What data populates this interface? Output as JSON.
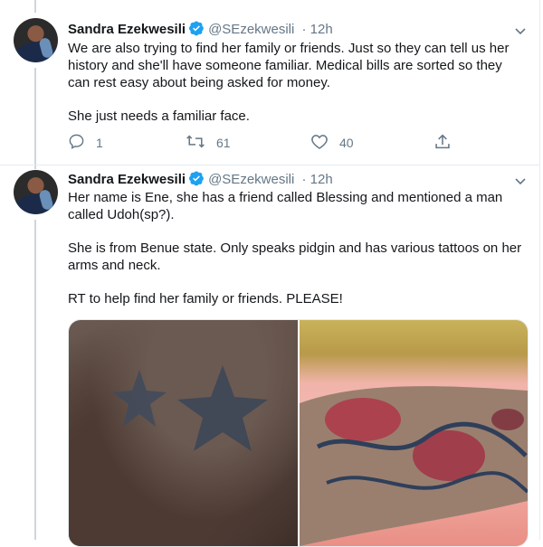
{
  "tweets": [
    {
      "author_name": "Sandra Ezekwesili",
      "handle": "@SEzekwesili",
      "time": "· 12h",
      "paragraphs": [
        "We are also trying to find her family or friends. Just so they can tell us her history and she'll have someone familiar. Medical bills are sorted so they can rest easy about being asked for money.",
        "She just needs a familiar face."
      ],
      "replies": "1",
      "retweets": "61",
      "likes": "40"
    },
    {
      "author_name": "Sandra Ezekwesili",
      "handle": "@SEzekwesili",
      "time": "· 12h",
      "paragraphs": [
        "Her name is Ene, she has a friend called Blessing and mentioned a man called Udoh(sp?).",
        "She is from Benue state. Only speaks pidgin and has various tattoos on her arms and neck.",
        "RT to help find her family or friends. PLEASE!"
      ]
    }
  ],
  "icons": {
    "verified": "verified-badge-icon",
    "reply": "reply-icon",
    "retweet": "retweet-icon",
    "like": "heart-icon",
    "share": "share-icon",
    "menu": "chevron-down-icon"
  },
  "colors": {
    "verified_blue": "#1da1f2",
    "secondary_text": "#657786",
    "primary_text": "#14171a",
    "thread_line": "#ccd6dd"
  }
}
